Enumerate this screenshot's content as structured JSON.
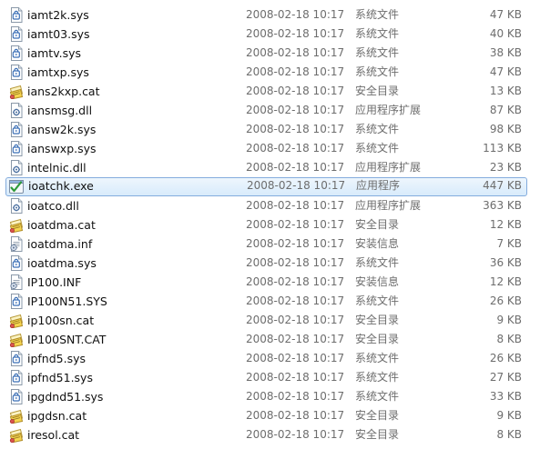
{
  "files": [
    {
      "name": "iamt2k.sys",
      "date": "2008-02-18 10:17",
      "type": "系统文件",
      "size": "47 KB",
      "icon": "sys-file-icon"
    },
    {
      "name": "iamt03.sys",
      "date": "2008-02-18 10:17",
      "type": "系统文件",
      "size": "40 KB",
      "icon": "sys-file-icon"
    },
    {
      "name": "iamtv.sys",
      "date": "2008-02-18 10:17",
      "type": "系统文件",
      "size": "38 KB",
      "icon": "sys-file-icon"
    },
    {
      "name": "iamtxp.sys",
      "date": "2008-02-18 10:17",
      "type": "系统文件",
      "size": "47 KB",
      "icon": "sys-file-icon"
    },
    {
      "name": "ians2kxp.cat",
      "date": "2008-02-18 10:17",
      "type": "安全目录",
      "size": "13 KB",
      "icon": "security-catalog-icon"
    },
    {
      "name": "iansmsg.dll",
      "date": "2008-02-18 10:17",
      "type": "应用程序扩展",
      "size": "87 KB",
      "icon": "dll-file-icon"
    },
    {
      "name": "iansw2k.sys",
      "date": "2008-02-18 10:17",
      "type": "系统文件",
      "size": "98 KB",
      "icon": "sys-file-icon"
    },
    {
      "name": "ianswxp.sys",
      "date": "2008-02-18 10:17",
      "type": "系统文件",
      "size": "113 KB",
      "icon": "sys-file-icon"
    },
    {
      "name": "intelnic.dll",
      "date": "2008-02-18 10:17",
      "type": "应用程序扩展",
      "size": "23 KB",
      "icon": "dll-file-icon"
    },
    {
      "name": "ioatchk.exe",
      "date": "2008-02-18 10:17",
      "type": "应用程序",
      "size": "447 KB",
      "icon": "exe-file-icon",
      "selected": true
    },
    {
      "name": "ioatco.dll",
      "date": "2008-02-18 10:17",
      "type": "应用程序扩展",
      "size": "363 KB",
      "icon": "dll-file-icon"
    },
    {
      "name": "ioatdma.cat",
      "date": "2008-02-18 10:17",
      "type": "安全目录",
      "size": "12 KB",
      "icon": "security-catalog-icon"
    },
    {
      "name": "ioatdma.inf",
      "date": "2008-02-18 10:17",
      "type": "安装信息",
      "size": "7 KB",
      "icon": "inf-file-icon"
    },
    {
      "name": "ioatdma.sys",
      "date": "2008-02-18 10:17",
      "type": "系统文件",
      "size": "36 KB",
      "icon": "sys-file-icon"
    },
    {
      "name": "IP100.INF",
      "date": "2008-02-18 10:17",
      "type": "安装信息",
      "size": "12 KB",
      "icon": "inf-file-icon"
    },
    {
      "name": "IP100N51.SYS",
      "date": "2008-02-18 10:17",
      "type": "系统文件",
      "size": "26 KB",
      "icon": "sys-file-icon"
    },
    {
      "name": "ip100sn.cat",
      "date": "2008-02-18 10:17",
      "type": "安全目录",
      "size": "9 KB",
      "icon": "security-catalog-icon"
    },
    {
      "name": "IP100SNT.CAT",
      "date": "2008-02-18 10:17",
      "type": "安全目录",
      "size": "8 KB",
      "icon": "security-catalog-icon"
    },
    {
      "name": "ipfnd5.sys",
      "date": "2008-02-18 10:17",
      "type": "系统文件",
      "size": "26 KB",
      "icon": "sys-file-icon"
    },
    {
      "name": "ipfnd51.sys",
      "date": "2008-02-18 10:17",
      "type": "系统文件",
      "size": "27 KB",
      "icon": "sys-file-icon"
    },
    {
      "name": "ipgdnd51.sys",
      "date": "2008-02-18 10:17",
      "type": "系统文件",
      "size": "33 KB",
      "icon": "sys-file-icon"
    },
    {
      "name": "ipgdsn.cat",
      "date": "2008-02-18 10:17",
      "type": "安全目录",
      "size": "9 KB",
      "icon": "security-catalog-icon"
    },
    {
      "name": "iresol.cat",
      "date": "2008-02-18 10:17",
      "type": "安全目录",
      "size": "8 KB",
      "icon": "security-catalog-icon"
    }
  ],
  "colors": {
    "selection_fill": "#dcecfc",
    "selection_border": "#84acdd",
    "meta_text": "#6d6d6d",
    "name_text": "#101010"
  }
}
